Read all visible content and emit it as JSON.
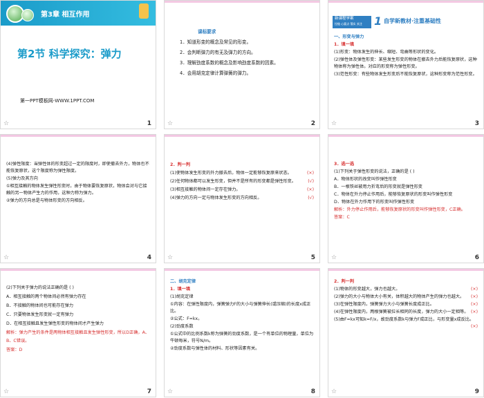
{
  "slides": [
    {
      "page": "1",
      "chapter": "第3章 相互作用",
      "section": "第2节 科学探究：弹力",
      "footer": "第一PPT模板网-WWW.1PPT.COM"
    },
    {
      "page": "2",
      "title": "课标要求",
      "lines": [
        "1．知道形变的概念及常见的形变。",
        "2．会判断弹力的有无及弹力的方向。",
        "3．理解劲度系数的概念及影响劲度系数的因素。",
        "4．会用胡克定律计算弹簧的弹力。"
      ]
    },
    {
      "page": "3",
      "badge_top": "新课程学案",
      "badge_bottom": "拉链 心要点 落实 关注",
      "header_num": "1",
      "header_text": "自学新教材·注重基础性",
      "sub1": "一、形变与弹力",
      "sub2": "1．填一填",
      "lines": [
        "(1)形变：物体发生的伸长、缩短、弯曲等形状的变化。",
        "(2)弹性体及弹性形变：某些发生形变的物体在撤去外力后能恢复原状，这种物体称为弹性体。对应的形变称为弹性形变。",
        "(3)范性形变：有些物体发生形变后不能恢复原状，这种形变称为范性形变。"
      ]
    },
    {
      "page": "4",
      "lines": [
        "(4)弹性限度：当弹性体的形变超过一定的限度时，即使撤去外力，物体也不能恢复原状，这个限度称为弹性限度。",
        "(5)弹力及其方向",
        "①相互接触的物体发生弹性形变时，由于物体要恢复原状，物体会对与它接触的另一物体产生力的作用，这种力称为弹力。",
        "②弹力的方向总是与物体形变的方向相反。"
      ]
    },
    {
      "page": "5",
      "title": "2．判一判",
      "items": [
        {
          "text": "(1)使物体发生形变的外力撤去后，物体一定能够恢复原来状态。",
          "mark": "(×)"
        },
        {
          "text": "(2)任何物体都可以发生形变，但并不是所有的形变都是弹性形变。",
          "mark": "(√)"
        },
        {
          "text": "(3)相互接触的物体间一定存在弹力。",
          "mark": "(×)"
        },
        {
          "text": "(4)弹力的方向一定与物体发生形变的方向相反。",
          "mark": "(√)"
        }
      ]
    },
    {
      "page": "6",
      "title": "3．选一选",
      "question": "(1)下列关于弹性形变的说法，正确的是        (    )",
      "options": [
        "A．物体形状的改变叫作弹性形变",
        "B．一根铁丝被用力折弯后的形变就是弹性形变",
        "C．物体在外力停止作用后，能够恢复原状的形变叫作弹性形变",
        "D．物体在外力作用下的形变叫作弹性形变"
      ],
      "explain": "解析：外力停止作用后，能够恢复原状的形变叫作弹性形变，C正确。",
      "answer": "答案：C"
    },
    {
      "page": "7",
      "question": "(2)下列关于弹力的说法正确的是        (    )",
      "options": [
        "A．相互接触的两个物体间必然有弹力存在",
        "B．不接触的物体间也可能存在弹力",
        "C．只要物体发生形变就一定有弹力",
        "D．在相互接触且发生弹性形变的物体间才产生弹力"
      ],
      "explain": "解析：弹力产生的条件是两物体相互接触且发生弹性形变，所以D正确，A、B、C错误。",
      "answer": "答案：D"
    },
    {
      "page": "8",
      "title": "二、胡克定律",
      "sub": "1．填一填",
      "lines": [
        "(1)胡克定律",
        "①内容：在弹性限度内，弹簧弹力F的大小与弹簧伸长(或压缩)的长度x成正比。",
        "②公式：F=kx。",
        "(2)劲度系数",
        "①公式中的比例系数k称为弹簧的劲度系数，是一个有单位的物理量，单位为牛顿每米，符号N/m。",
        "②劲度系数与弹性体的材料、形状等因素有关。"
      ]
    },
    {
      "page": "9",
      "title": "2．判一判",
      "items": [
        {
          "text": "(1)物体的形变越大，弹力也越大。",
          "mark": "(×)"
        },
        {
          "text": "(2)弹力的大小与物体大小有关，体积越大的物体产生的弹力也越大。",
          "mark": "(×)"
        },
        {
          "text": "(3)在弹性限度内，弹簧弹力大小与弹簧长度成正比。",
          "mark": "(×)"
        },
        {
          "text": "(4)在弹性限度内，两根弹簧被拉长相同的长度，弹力的大小一定相等。",
          "mark": "(×)"
        },
        {
          "text": "(5)由F=kx可知k=F/x，故劲度系数k与弹力F成正比，与形变量x成反比。",
          "mark": "(×)"
        }
      ]
    }
  ]
}
